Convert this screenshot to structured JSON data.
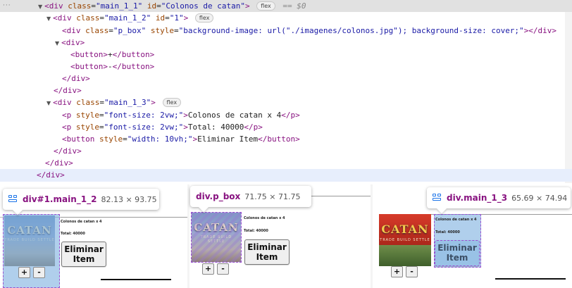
{
  "devtools": {
    "more_dots": "···",
    "eq_marker": "== $0",
    "badge_flex": "flex",
    "lines": {
      "l0": {
        "open": "<div ",
        "a1": "class",
        "v1": "\"main_1_1\"",
        "a2": "id",
        "v2": "\"Colonos de catan\"",
        "close": ">"
      },
      "l1": {
        "open": "<div ",
        "a1": "class",
        "v1": "\"main_1_2\"",
        "a2": "id",
        "v2": "\"1\"",
        "close": ">"
      },
      "l2": {
        "open": "<div ",
        "a1": "class",
        "v1": "\"p_box\"",
        "a2": "style",
        "v2": "\"background-image: url(\"./imagenes/colonos.jpg\"); background-size: cover;\"",
        "close": "></div>"
      },
      "l3": {
        "text": "<div>"
      },
      "l4": {
        "t1": "<button>",
        "tx": "+",
        "t2": "</button>"
      },
      "l5": {
        "t1": "<button>",
        "tx": "-",
        "t2": "</button>"
      },
      "l6": {
        "text": "</div>"
      },
      "l7": {
        "text": "</div>"
      },
      "l8": {
        "open": "<div ",
        "a1": "class",
        "v1": "\"main_1_3\"",
        "close": ">"
      },
      "l9": {
        "t1": "<p ",
        "a1": "style",
        "v1": "\"font-size: 2vw;\"",
        "t2": ">",
        "tx": "Colonos de catan x 4",
        "t3": "</p>"
      },
      "l10": {
        "t1": "<p ",
        "a1": "style",
        "v1": "\"font-size: 2vw;\"",
        "t2": ">",
        "tx": "Total: 40000",
        "t3": "</p>"
      },
      "l11": {
        "t1": "<button ",
        "a1": "style",
        "v1": "\"width: 10vh;\"",
        "t2": ">",
        "tx": "Eliminar Item",
        "t3": "</button>"
      },
      "l12": {
        "text": "</div>"
      },
      "l13": {
        "text": "</div>"
      },
      "l14": {
        "text": "</div>"
      }
    }
  },
  "preview": {
    "cover_title": "CATAN",
    "cover_sub": "TRADE BUILD SETTLE",
    "item_text": "Colonos de catan x 4",
    "total_text": "Total: 40000",
    "delete_line1": "Eliminar",
    "delete_line2": "Item",
    "plus": "+",
    "minus": "-",
    "partial_label": "Dear Stun"
  },
  "tooltips": [
    {
      "name": "div#1.main_1_2",
      "size": "82.13 × 93.75"
    },
    {
      "name": "div.p_box",
      "size": "71.75 × 71.75"
    },
    {
      "name": "div.main_1_3",
      "size": "65.69 × 74.94"
    }
  ],
  "colors": {
    "tag": "#881280",
    "attr_name": "#994500",
    "attr_value": "#1a1aa6",
    "highlight": "#6fa8dc"
  }
}
